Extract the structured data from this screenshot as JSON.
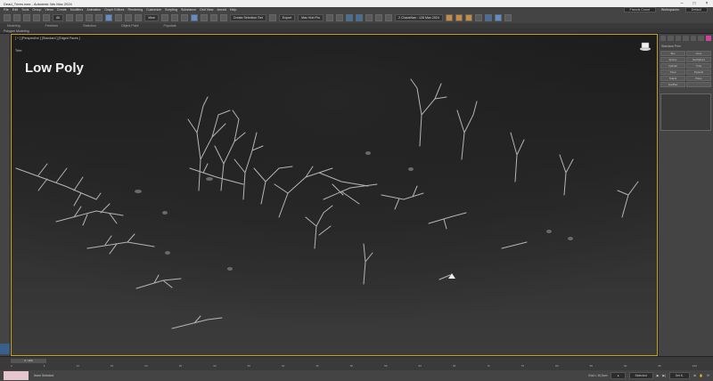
{
  "title": "Dead_Trees.max - Autodesk 3ds Max 2024",
  "menu": [
    "File",
    "Edit",
    "Tools",
    "Group",
    "Views",
    "Create",
    "Modifiers",
    "Animation",
    "Graph Editors",
    "Rendering",
    "Customize",
    "Scripting",
    "Substance",
    "Civil View",
    "Arnold",
    "Help"
  ],
  "user": "Francis Count",
  "workspace_label": "Workspaces:",
  "workspace_value": "Default",
  "toolbar": {
    "selection_filter": "All",
    "view": "View",
    "selection_set": "Create Selection Set",
    "export": "Export",
    "render_preset": "Max Hub Pro",
    "render_target": "2 ChaosNan : 128 Max 2024"
  },
  "ribbon": [
    "Modeling",
    "Freeform",
    "Selection",
    "Object Paint",
    "Populate"
  ],
  "subribbon": "Polygon Modeling",
  "viewport": {
    "label": "[ + ] [Perspective ] [Standard ] [Edged Faces ]",
    "trim_label": "Trim:",
    "overlay_title": "Low Poly"
  },
  "cmd_panel": {
    "section": "Standard Prim",
    "buttons": [
      "Box",
      "Cone",
      "Sphere",
      "GeoSphere",
      "Cylinder",
      "Tube",
      "Torus",
      "Pyramid",
      "Teapot",
      "Plane",
      "TextPlus",
      ""
    ]
  },
  "timeline": {
    "frame_label": "0 / 100",
    "ticks": [
      "0",
      "5",
      "10",
      "15",
      "20",
      "25",
      "30",
      "35",
      "40",
      "45",
      "50",
      "55",
      "60",
      "65",
      "70",
      "75",
      "80",
      "85",
      "90",
      "95",
      "100"
    ]
  },
  "status": {
    "left": "None Selected",
    "grid": "Grid = 10,0cm",
    "selected": "Selected",
    "key_filters": "Set K."
  },
  "colors": {
    "viewport_border": "#c6a323",
    "accent_pink": "#d0459c"
  }
}
